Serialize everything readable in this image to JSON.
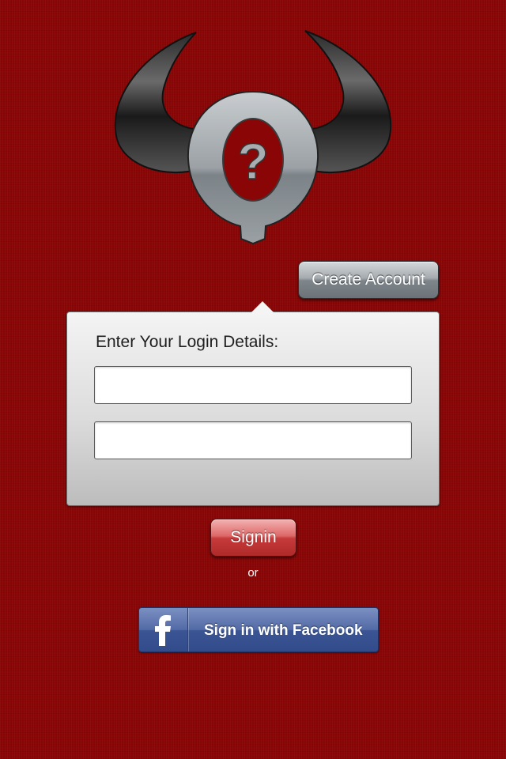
{
  "create_account": {
    "label": "Create Account"
  },
  "login": {
    "title": "Enter Your Login Details:",
    "username": {
      "value": "",
      "placeholder": ""
    },
    "password": {
      "value": "",
      "placeholder": ""
    }
  },
  "signin": {
    "label": "Signin"
  },
  "separator": {
    "text": "or"
  },
  "facebook": {
    "label": "Sign in with Facebook",
    "icon": "facebook-f-icon"
  },
  "logo": {
    "icon": "horned-question-mark-logo"
  },
  "colors": {
    "background": "#8a0606",
    "signin": "#c63a3a",
    "facebook": "#3b5594",
    "create_account": "#7f868b"
  }
}
